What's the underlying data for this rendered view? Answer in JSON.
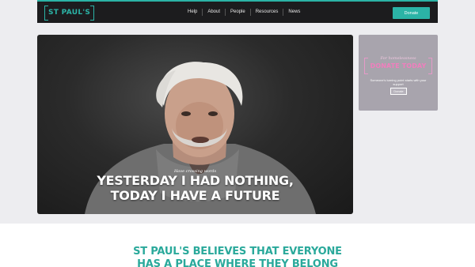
{
  "header": {
    "logo_text": "ST PAUL'S",
    "nav": [
      "Help",
      "About",
      "People",
      "Resources",
      "News"
    ],
    "donate_label": "Donate"
  },
  "hero": {
    "small_text": "Have crossing words",
    "line1": "YESTERDAY I HAD NOTHING,",
    "line2": "TODAY I HAVE A FUTURE"
  },
  "donate_card": {
    "script": "For homelessness",
    "title": "DONATE TODAY",
    "subtitle": "Someone's turning point starts with your support",
    "button": "Donate"
  },
  "mission": {
    "line1": "ST PAUL'S BELIEVES THAT EVERYONE",
    "line2": "HAS A PLACE WHERE THEY BELONG"
  },
  "colors": {
    "accent": "#2bb3a6",
    "pink": "#f07ebd",
    "header_bg": "#1c1c1e"
  }
}
